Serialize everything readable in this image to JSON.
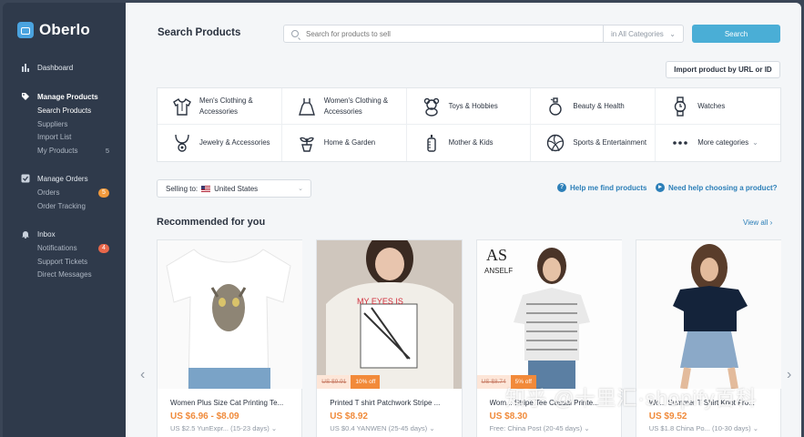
{
  "app": {
    "logo": "Oberlo"
  },
  "sidebar": {
    "dashboard": "Dashboard",
    "manage_products": {
      "label": "Manage Products",
      "items": [
        {
          "label": "Search Products",
          "count": ""
        },
        {
          "label": "Suppliers",
          "count": ""
        },
        {
          "label": "Import List",
          "count": ""
        },
        {
          "label": "My Products",
          "count": "5"
        }
      ]
    },
    "manage_orders": {
      "label": "Manage Orders",
      "items": [
        {
          "label": "Orders",
          "badge": "5"
        },
        {
          "label": "Order Tracking",
          "badge": ""
        }
      ]
    },
    "inbox": {
      "label": "Inbox",
      "items": [
        {
          "label": "Notifications",
          "badge": "4"
        },
        {
          "label": "Support Tickets",
          "badge": ""
        },
        {
          "label": "Direct Messages",
          "badge": ""
        }
      ]
    }
  },
  "header": {
    "title": "Search Products",
    "search_placeholder": "Search for products to sell",
    "category": "in All Categories",
    "search_button": "Search",
    "import_button": "Import product by URL or ID"
  },
  "categories": [
    {
      "label": "Men's Clothing & Accessories",
      "icon": "shirt-icon"
    },
    {
      "label": "Women's Clothing & Accessories",
      "icon": "dress-icon"
    },
    {
      "label": "Toys & Hobbies",
      "icon": "bear-icon"
    },
    {
      "label": "Beauty & Health",
      "icon": "perfume-icon"
    },
    {
      "label": "Watches",
      "icon": "watch-icon"
    },
    {
      "label": "Jewelry & Accessories",
      "icon": "necklace-icon"
    },
    {
      "label": "Home & Garden",
      "icon": "plant-icon"
    },
    {
      "label": "Mother & Kids",
      "icon": "bottle-icon"
    },
    {
      "label": "Sports & Entertainment",
      "icon": "ball-icon"
    },
    {
      "label": "More categories",
      "icon": "dots-icon"
    }
  ],
  "filters": {
    "selling_to_label": "Selling to:",
    "selling_to_value": "United States",
    "help1": "Help me find products",
    "help2": "Need help choosing a product?"
  },
  "recommended": {
    "title": "Recommended for you",
    "view_all": "View all",
    "products": [
      {
        "name": "Women Plus Size Cat Printing Te...",
        "price": "US $6.96 - $8.09",
        "original": "",
        "discount": "",
        "shipping": "US $2.5 YunExpr...",
        "days": "(15-23 days)"
      },
      {
        "name": "Printed T shirt Patchwork Stripe ...",
        "price": "US $8.92",
        "original": "US $9.91",
        "discount": "10% off",
        "shipping": "US $0.4 YANWEN",
        "days": "(25-45 days)"
      },
      {
        "name": "Wom... Stripe Tee Casual Printe...",
        "price": "US $8.30",
        "original": "US $8.74",
        "discount": "5% off",
        "shipping": "Free: China Post",
        "days": "(20-45 days)"
      },
      {
        "name": "Wo... Summer T Shirt Knot Fro...",
        "price": "US $9.52",
        "original": "",
        "discount": "",
        "shipping": "US $1.8 China Po...",
        "days": "(10-30 days)"
      }
    ]
  },
  "watermark": "知乎 @十里汇·shopify百科",
  "colors": {
    "sidebar": "#2f3a4b",
    "accent": "#4aaed6",
    "price": "#f08a3a",
    "link": "#2c7fb8"
  }
}
